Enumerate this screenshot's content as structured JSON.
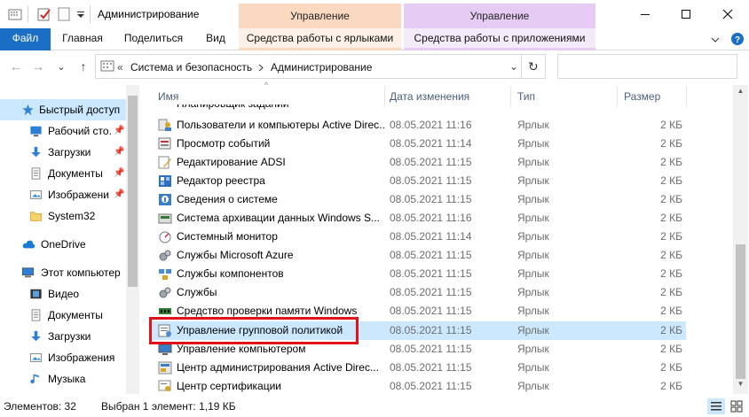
{
  "window": {
    "title": "Администрирование",
    "context_tab_1": "Управление",
    "context_tab_2": "Управление",
    "minimize": "—",
    "maximize": "☐",
    "close": "✕"
  },
  "ribbon": {
    "file": "Файл",
    "home": "Главная",
    "share": "Поделиться",
    "view": "Вид",
    "shortcut_tools": "Средства работы с ярлыками",
    "app_tools": "Средства работы с приложениями"
  },
  "address": {
    "segment_1": "Система и безопасность",
    "segment_2": "Администрирование",
    "back": "←",
    "forward": "→",
    "recent": "⌄",
    "up": "↑",
    "overflow": "«",
    "dropdown": "⌄",
    "refresh": "↻",
    "search_placeholder": ""
  },
  "nav": {
    "items": [
      {
        "label": "Быстрый доступ",
        "pinned": false,
        "icon": "star-icon"
      },
      {
        "label": "Рабочий сто.",
        "pinned": true,
        "icon": "desktop-icon"
      },
      {
        "label": "Загрузки",
        "pinned": true,
        "icon": "download-icon"
      },
      {
        "label": "Документы",
        "pinned": true,
        "icon": "documents-icon"
      },
      {
        "label": "Изображени",
        "pinned": true,
        "icon": "pictures-icon"
      },
      {
        "label": "System32",
        "pinned": false,
        "icon": "folder-icon"
      },
      {
        "label": "OneDrive",
        "pinned": false,
        "icon": "cloud-icon"
      },
      {
        "label": "Этот компьютер",
        "pinned": false,
        "icon": "computer-icon"
      },
      {
        "label": "Видео",
        "pinned": false,
        "icon": "video-icon"
      },
      {
        "label": "Документы",
        "pinned": false,
        "icon": "documents-icon"
      },
      {
        "label": "Загрузки",
        "pinned": false,
        "icon": "download-icon"
      },
      {
        "label": "Изображения",
        "pinned": false,
        "icon": "pictures-icon"
      },
      {
        "label": "Музыка",
        "pinned": false,
        "icon": "music-icon"
      }
    ],
    "pin_glyph": "📌"
  },
  "list": {
    "columns": {
      "name": "Имя",
      "date": "Дата изменения",
      "type": "Тип",
      "size": "Размер"
    },
    "sort_glyph": "^",
    "partial_row": "Планировщик заданий",
    "rows": [
      {
        "name": "Пользователи и компьютеры Active Direc...",
        "date": "08.05.2021 11:16",
        "type": "Ярлык",
        "size": "2 КБ",
        "icon": "users-icon"
      },
      {
        "name": "Просмотр событий",
        "date": "08.05.2021 11:14",
        "type": "Ярлык",
        "size": "2 КБ",
        "icon": "event-viewer-icon"
      },
      {
        "name": "Редактирование ADSI",
        "date": "08.05.2021 11:15",
        "type": "Ярлык",
        "size": "2 КБ",
        "icon": "adsi-icon"
      },
      {
        "name": "Редактор реестра",
        "date": "08.05.2021 11:15",
        "type": "Ярлык",
        "size": "2 КБ",
        "icon": "registry-icon"
      },
      {
        "name": "Сведения о системе",
        "date": "08.05.2021 11:15",
        "type": "Ярлык",
        "size": "2 КБ",
        "icon": "system-info-icon"
      },
      {
        "name": "Система архивации данных Windows S...",
        "date": "08.05.2021 11:16",
        "type": "Ярлык",
        "size": "2 КБ",
        "icon": "backup-icon"
      },
      {
        "name": "Системный монитор",
        "date": "08.05.2021 11:14",
        "type": "Ярлык",
        "size": "2 КБ",
        "icon": "monitor-icon"
      },
      {
        "name": "Службы Microsoft Azure",
        "date": "08.05.2021 11:15",
        "type": "Ярлык",
        "size": "2 КБ",
        "icon": "services-icon"
      },
      {
        "name": "Службы компонентов",
        "date": "08.05.2021 11:15",
        "type": "Ярлык",
        "size": "2 КБ",
        "icon": "component-services-icon"
      },
      {
        "name": "Службы",
        "date": "08.05.2021 11:15",
        "type": "Ярлык",
        "size": "2 КБ",
        "icon": "services-icon"
      },
      {
        "name": "Средство проверки памяти Windows",
        "date": "08.05.2021 11:15",
        "type": "Ярлык",
        "size": "2 КБ",
        "icon": "memory-icon"
      },
      {
        "name": "Управление групповой политикой",
        "date": "08.05.2021 11:15",
        "type": "Ярлык",
        "size": "2 КБ",
        "icon": "group-policy-icon",
        "selected": true
      },
      {
        "name": "Управление компьютером",
        "date": "08.05.2021 11:15",
        "type": "Ярлык",
        "size": "2 КБ",
        "icon": "computer-management-icon"
      },
      {
        "name": "Центр администрирования Active Direc...",
        "date": "08.05.2021 11:15",
        "type": "Ярлык",
        "size": "2 КБ",
        "icon": "ad-admin-center-icon"
      },
      {
        "name": "Центр сертификации",
        "date": "08.05.2021 11:15",
        "type": "Ярлык",
        "size": "2 КБ",
        "icon": "certificate-icon"
      }
    ]
  },
  "status": {
    "count": "Элементов: 32",
    "selection": "Выбран 1 элемент: 1,19 КБ"
  },
  "colors": {
    "accent": "#1a6fc4",
    "selection": "#cce8ff",
    "highlight_box": "#e0121b",
    "context_shortcut": "#fbd9c1",
    "context_app": "#e6ccf5"
  }
}
